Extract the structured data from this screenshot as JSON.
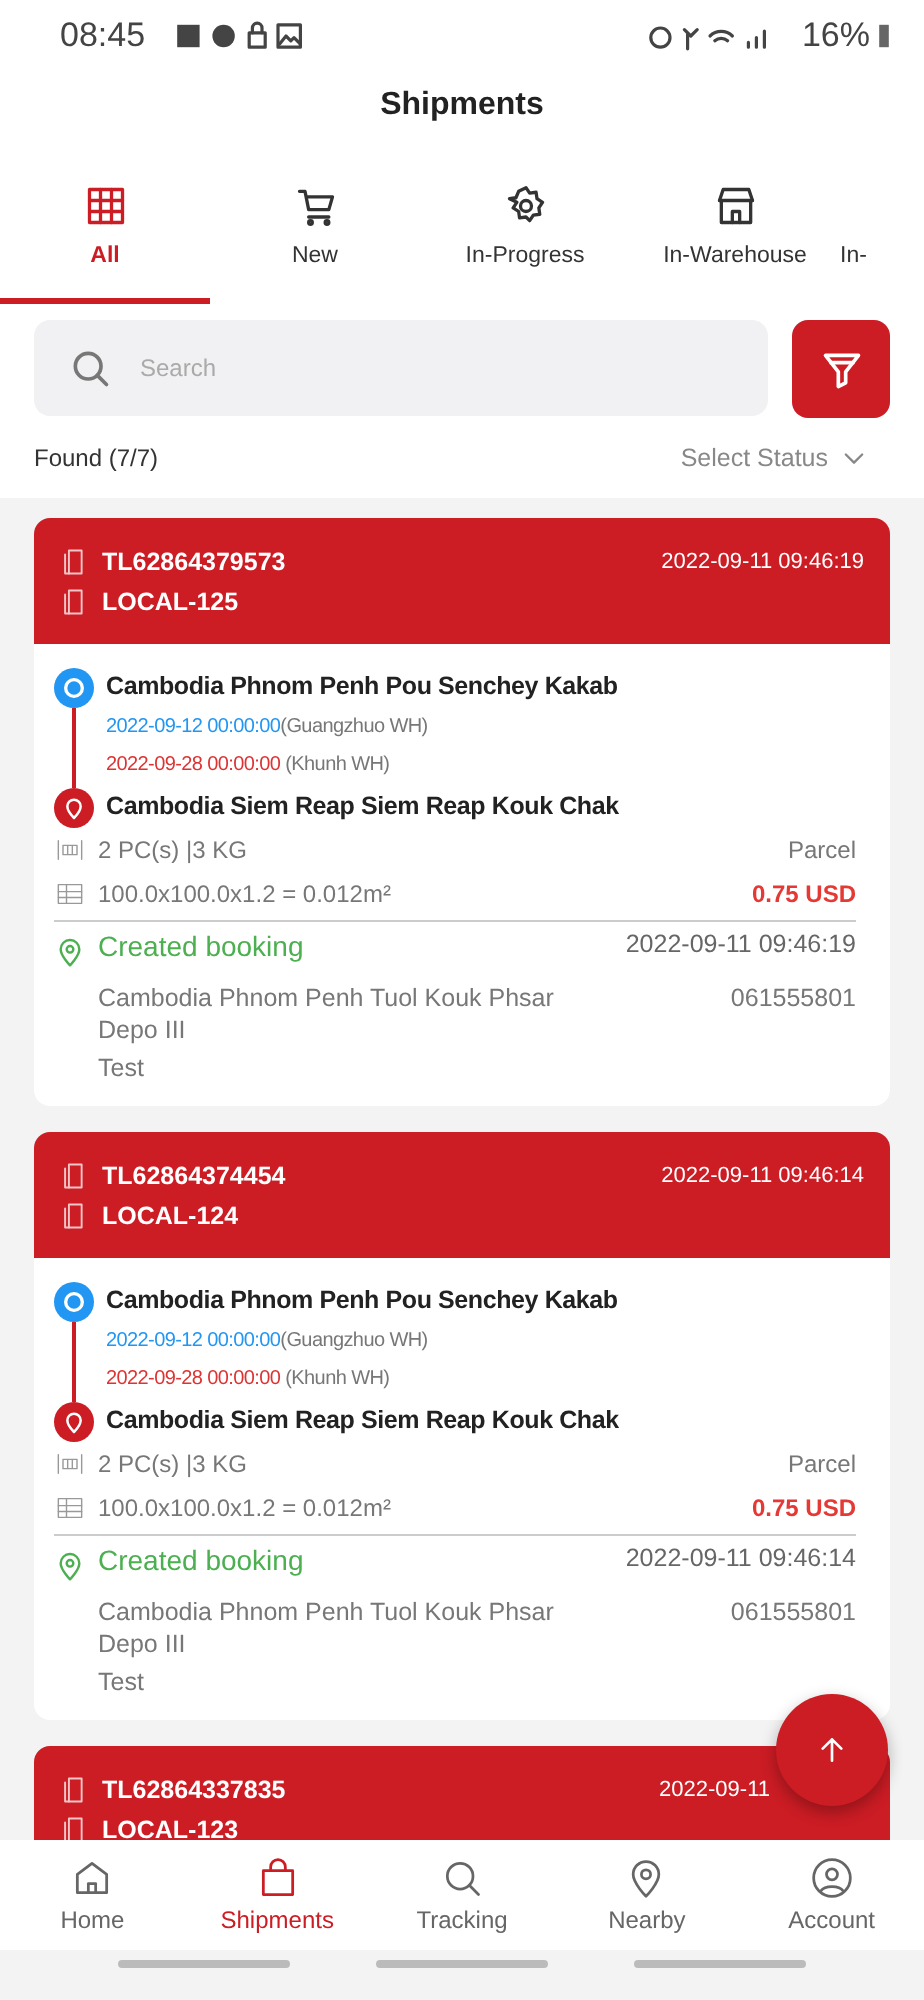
{
  "status_bar": {
    "time": "08:45",
    "battery": "16%"
  },
  "header": {
    "title": "Shipments"
  },
  "tabs": [
    {
      "label": "All",
      "selected": true
    },
    {
      "label": "New",
      "selected": false
    },
    {
      "label": "In-Progress",
      "selected": false
    },
    {
      "label": "In-Warehouse",
      "selected": false
    },
    {
      "label": "In-",
      "selected": false
    }
  ],
  "search": {
    "placeholder": "Search"
  },
  "found": "Found (7/7)",
  "status_select": "Select Status",
  "shipments": [
    {
      "tracking": "TL62864379573",
      "reference": "LOCAL-125",
      "created": "2022-09-11 09:46:19",
      "origin": "Cambodia Phnom Penh Pou Senchey Kakab",
      "depart_date": "2022-09-12 00:00:00",
      "depart_wh": "(Guangzhuo WH)",
      "arrive_date": "2022-09-28 00:00:00",
      "arrive_wh": " (Khunh WH)",
      "destination": "Cambodia Siem Reap Siem Reap Kouk Chak",
      "pieces": "2 PC(s)  |3 KG",
      "type": "Parcel",
      "dimensions": "100.0x100.0x1.2 = 0.012m²",
      "price": "0.75 USD",
      "status": {
        "label": "Created booking",
        "kind": "created"
      },
      "status_time": "2022-09-11 09:46:19",
      "address": "Cambodia Phnom Penh Tuol Kouk Phsar Depo III",
      "phone": "061555801",
      "note": "Test"
    },
    {
      "tracking": "TL62864374454",
      "reference": "LOCAL-124",
      "created": "2022-09-11 09:46:14",
      "origin": "Cambodia Phnom Penh Pou Senchey Kakab",
      "depart_date": "2022-09-12 00:00:00",
      "depart_wh": "(Guangzhuo WH)",
      "arrive_date": "2022-09-28 00:00:00",
      "arrive_wh": " (Khunh WH)",
      "destination": "Cambodia Siem Reap Siem Reap Kouk Chak",
      "pieces": "2 PC(s)  |3 KG",
      "type": "Parcel",
      "dimensions": "100.0x100.0x1.2 = 0.012m²",
      "price": "0.75 USD",
      "status": {
        "label": "Created booking",
        "kind": "created"
      },
      "status_time": "2022-09-11 09:46:14",
      "address": "Cambodia Phnom Penh Tuol Kouk Phsar Depo III",
      "phone": "061555801",
      "note": "Test"
    },
    {
      "tracking": "TL62864337835",
      "reference": "LOCAL-123",
      "created": "2022-09-11"
    }
  ],
  "bottom_nav": [
    {
      "label": "Home",
      "selected": false
    },
    {
      "label": "Shipments",
      "selected": true
    },
    {
      "label": "Tracking",
      "selected": false
    },
    {
      "label": "Nearby",
      "selected": false
    },
    {
      "label": "Account",
      "selected": false
    }
  ]
}
